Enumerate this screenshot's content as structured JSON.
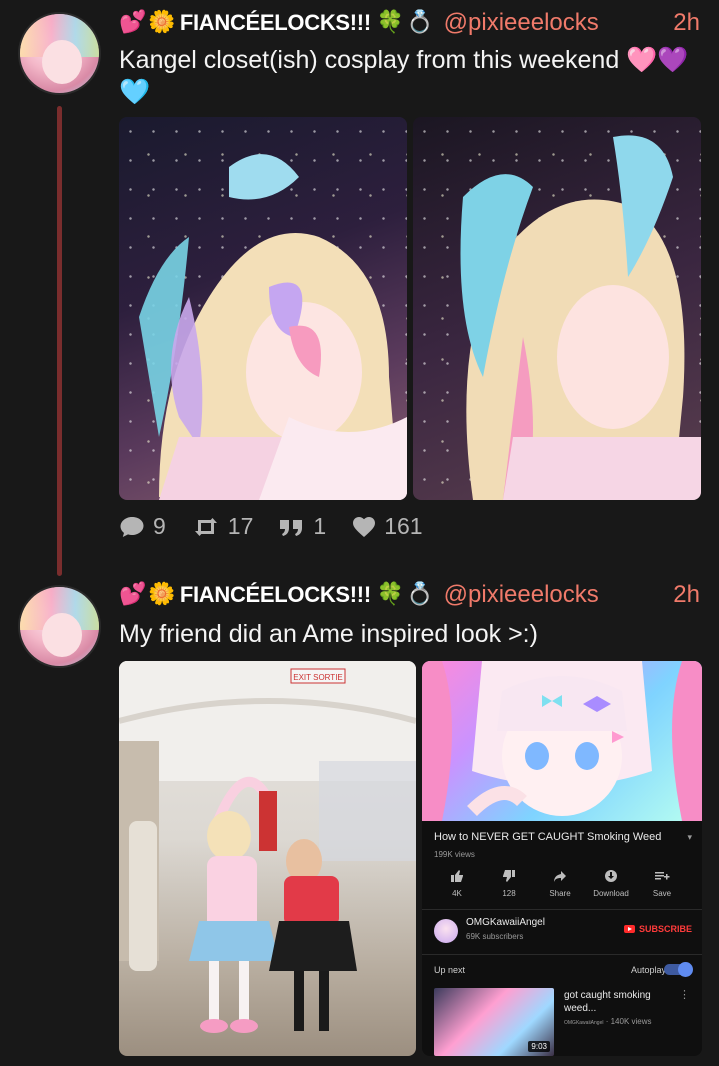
{
  "posts": [
    {
      "author": {
        "emoji_prefix": [
          "💕",
          "🌼"
        ],
        "display_name": "FIANCÉELOCKS!!!",
        "emoji_suffix": [
          "🍀",
          "💍"
        ],
        "handle": "@pixieeelocks"
      },
      "time": "2h",
      "text_lines": [
        "Kangel closet(ish) cosplay from this weekend 🩷💜",
        "🩵"
      ],
      "images": [
        {
          "description_icon": "photo-icon"
        },
        {
          "description_icon": "photo-icon"
        }
      ],
      "stats": {
        "replies": "9",
        "reposts": "17",
        "quotes": "1",
        "likes": "161"
      }
    },
    {
      "author": {
        "emoji_prefix": [
          "💕",
          "🌼"
        ],
        "display_name": "FIANCÉELOCKS!!!",
        "emoji_suffix": [
          "🍀",
          "💍"
        ],
        "handle": "@pixieeelocks"
      },
      "time": "2h",
      "text": "My friend did an Ame inspired look >:)",
      "photo": {
        "exit_sign": "EXIT SORTIE"
      },
      "video": {
        "title": "How to NEVER GET CAUGHT Smoking Weed",
        "views": "199K views",
        "actions": [
          {
            "icon": "thumbs-up-icon",
            "label": "4K"
          },
          {
            "icon": "thumbs-down-icon",
            "label": "128"
          },
          {
            "icon": "share-icon",
            "label": "Share"
          },
          {
            "icon": "download-icon",
            "label": "Download"
          },
          {
            "icon": "save-icon",
            "label": "Save"
          }
        ],
        "channel": {
          "name": "OMGKawaiiAngel",
          "subscribers": "69K subscribers",
          "subscribe_label": "SUBSCRIBE"
        },
        "up_next_label": "Up next",
        "autoplay_label": "Autoplay",
        "next": {
          "title": "got caught smoking weed...",
          "channel": "OMGKawaiiAngel",
          "views": "140K views",
          "duration": "9:03"
        }
      }
    }
  ]
}
